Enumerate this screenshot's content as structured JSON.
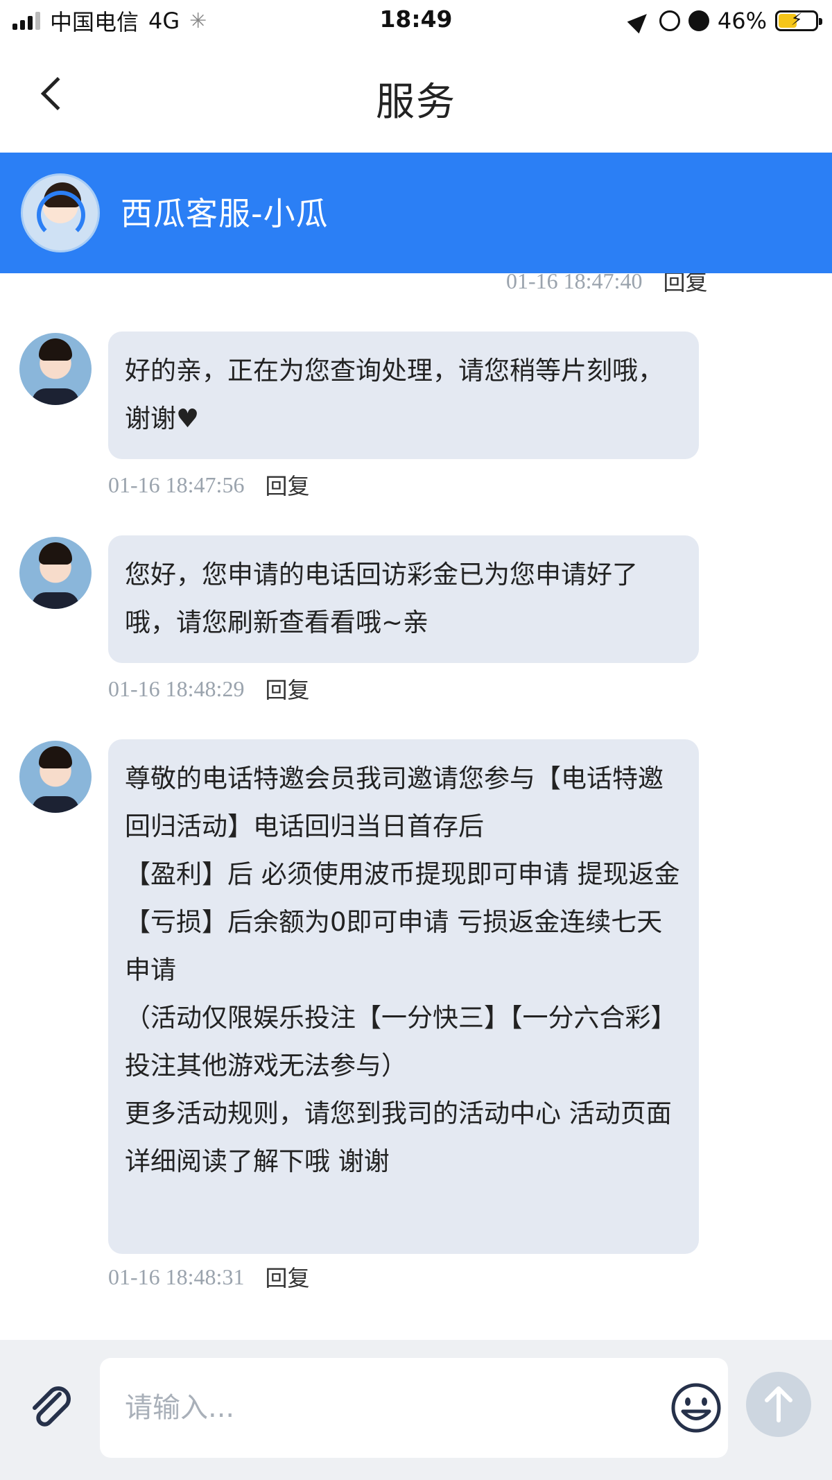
{
  "status_bar": {
    "carrier": "中国电信",
    "network": "4G",
    "time": "18:49",
    "battery_percent": "46%",
    "battery_level": 0.46
  },
  "header": {
    "title": "服务"
  },
  "agent": {
    "name": "西瓜客服-小瓜"
  },
  "messages": [
    {
      "partial": true,
      "timestamp": "01-16 18:47:40",
      "reply_label": "回复"
    },
    {
      "text": "好的亲，正在为您查询处理，请您稍等片刻哦，谢谢♥",
      "timestamp": "01-16 18:47:56",
      "reply_label": "回复"
    },
    {
      "text": "您好，您申请的电话回访彩金已为您申请好了哦，请您刷新查看看哦~亲",
      "timestamp": "01-16 18:48:29",
      "reply_label": "回复"
    },
    {
      "text": "尊敬的电话特邀会员我司邀请您参与【电话特邀回归活动】电话回归当日首存后\n【盈利】后 必须使用波币提现即可申请 提现返金\n【亏损】后余额为0即可申请 亏损返金连续七天申请\n（活动仅限娱乐投注【一分快三】【一分六合彩】投注其他游戏无法参与）\n更多活动规则，请您到我司的活动中心 活动页面详细阅读了解下哦 谢谢",
      "timestamp": "01-16 18:48:31",
      "reply_label": "回复"
    }
  ],
  "input": {
    "placeholder": "请输入...",
    "value": ""
  },
  "colors": {
    "accent": "#2b7ff5",
    "bubble": "#e4e9f2",
    "timestamp": "#9aa3ad",
    "input_bar": "#eef0f3",
    "send_disabled": "#cdd6e0"
  },
  "icons": [
    "back-chevron-icon",
    "paperclip-icon",
    "smiley-icon",
    "arrow-up-icon",
    "location-arrow-icon",
    "orientation-lock-icon",
    "alarm-icon",
    "battery-charging-icon"
  ]
}
